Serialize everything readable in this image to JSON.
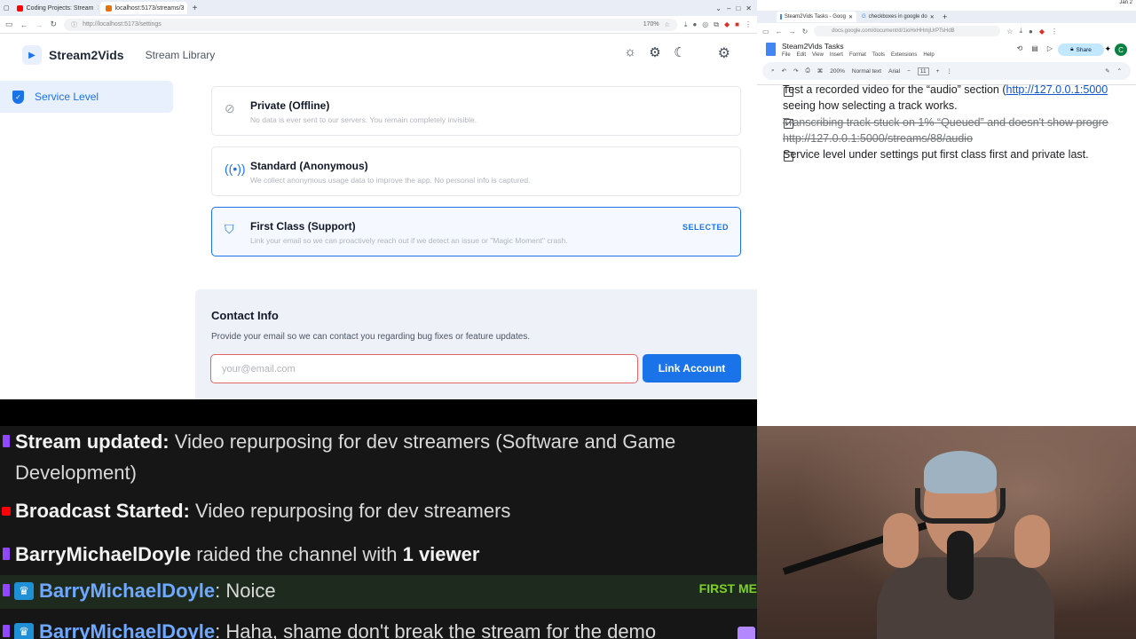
{
  "left_browser": {
    "tabs": [
      {
        "label": "Coding Projects: Stream",
        "color": "#ff0000"
      },
      {
        "label": "localhost:5173/streams/3",
        "color": "#e8710a"
      }
    ],
    "url": "http://localhost:5173/settings",
    "zoom": "170%"
  },
  "app": {
    "brand": "Stream2Vids",
    "nav_library": "Stream Library",
    "sidebar": {
      "service_level": "Service Level"
    },
    "levels": [
      {
        "title": "Private (Offline)",
        "desc": "No data is ever sent to our servers. You remain completely invisible.",
        "icon": "eye-off-icon",
        "selected": false
      },
      {
        "title": "Standard (Anonymous)",
        "desc": "We collect anonymous usage data to improve the app. No personal info is captured.",
        "icon": "broadcast-icon",
        "selected": false
      },
      {
        "title": "First Class (Support)",
        "desc": "Link your email so we can proactively reach out if we detect an issue or \"Magic Moment\" crash.",
        "icon": "shield-check-icon",
        "selected": true
      }
    ],
    "selected_label": "SELECTED",
    "contact": {
      "title": "Contact Info",
      "desc": "Provide your email so we can contact you regarding bug fixes or feature updates.",
      "email_placeholder": "your@email.com",
      "button": "Link Account"
    },
    "colors": {
      "accent": "#1a73e8",
      "input_border": "#e06666"
    }
  },
  "right_browser": {
    "sys_date": "Jan 2",
    "tabs": [
      {
        "label": "Steam2Vids Tasks - Goog"
      },
      {
        "label": "checkboxes in google do"
      }
    ],
    "url": "docs.google.com/document/d/1ioHxHHmjUrPTsHdB",
    "doc_title": "Steam2Vids Tasks",
    "menu": [
      "File",
      "Edit",
      "View",
      "Insert",
      "Format",
      "Tools",
      "Extensions",
      "Help"
    ],
    "share": "Share",
    "avatar": "C",
    "toolbar": {
      "zoom": "200%",
      "style": "Normal text",
      "font": "Arial",
      "size": "11"
    },
    "tasks": [
      {
        "text": "Test a recorded video for the “audio” section (",
        "link": "http://127.0.0.1:5000",
        "cont": "seeing how selecting a track works.",
        "checked": false
      },
      {
        "text": "Transcribing track stuck on 1% “Queued” and doesn't show progre",
        "cont": "http://127.0.0.1:5000/streams/88/audio",
        "checked": true
      },
      {
        "text": "Service level under settings put first class first and private last.",
        "checked": false
      }
    ]
  },
  "chat": {
    "messages": [
      {
        "platform": "twitch",
        "bold": "Stream updated:",
        "text": " Video repurposing for dev streamers (Software and Game",
        "cont": "Development)"
      },
      {
        "platform": "youtube",
        "bold": "Broadcast Started:",
        "text": " Video repurposing for dev streamers"
      },
      {
        "platform": "twitch",
        "bold": "BarryMichaelDoyle",
        "text": " raided the channel with ",
        "bold2": "1 viewer"
      },
      {
        "platform": "twitch",
        "user": "BarryMichaelDoyle",
        "text": ": Noice",
        "tag": "FIRST ME"
      },
      {
        "platform": "twitch",
        "user": "BarryMichaelDoyle",
        "text": ": Haha, shame don't break the stream for the demo"
      }
    ]
  }
}
